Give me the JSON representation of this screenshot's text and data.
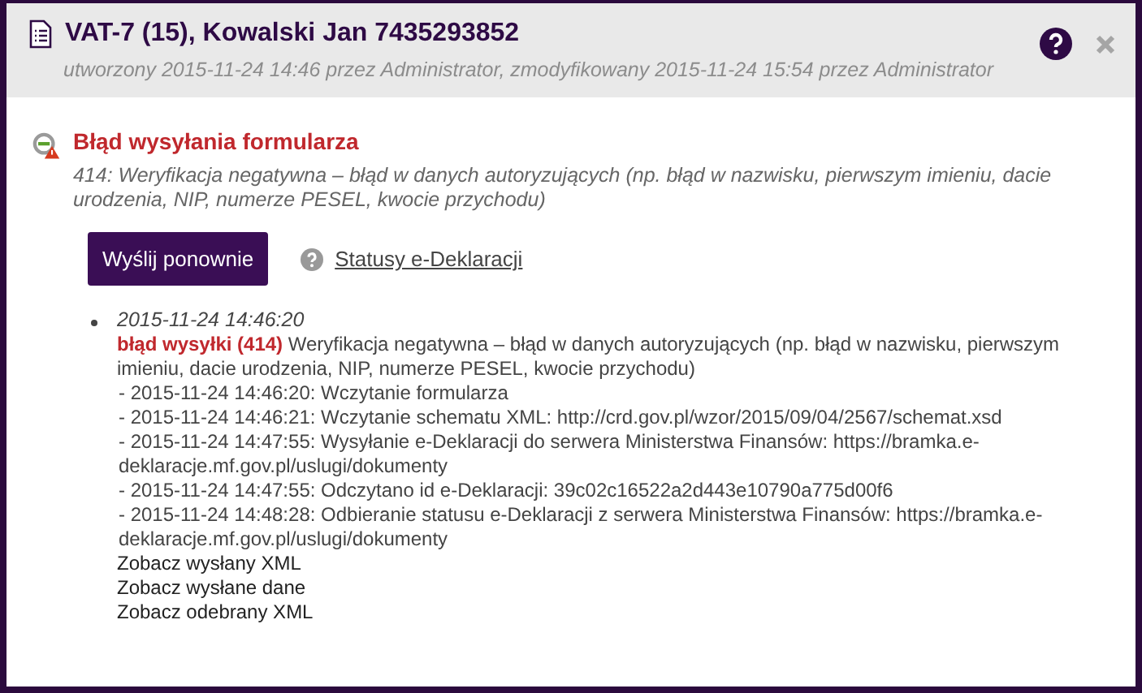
{
  "dialog": {
    "title": "VAT-7 (15), Kowalski Jan 7435293852",
    "subtitle": "utworzony 2015-11-24 14:46 przez Administrator, zmodyfikowany 2015-11-24 15:54 przez Administrator"
  },
  "error": {
    "title": "Błąd wysyłania formularza",
    "message": "414: Weryfikacja negatywna – błąd w danych autoryzujących (np. błąd w nazwisku, pierwszym imieniu, dacie urodzenia, NIP, numerze PESEL, kwocie przychodu)"
  },
  "actions": {
    "button": "Wyślij ponownie",
    "link": "Statusy e-Deklaracji"
  },
  "log": [
    {
      "time": "2015-11-24 14:46:20",
      "summary": "**błąd wysyłki (414)** Weryfikacja negatywna – błąd w danych autoryzujących (np. błąd w nazwisku, pierwszym imieniu, dacie urodzenia, NIP, numerze PESEL, kwocie przychodu)",
      "steps": [
        "- 2015-11-24 14:46:20: Wczytanie formularza",
        "- 2015-11-24 14:46:21: Wczytanie schematu XML: http://crd.gov.pl/wzor/2015/09/04/2567/schemat.xsd",
        "- 2015-11-24 14:47:55: Wysyłanie e-Deklaracji do serwera Ministerstwa Finansów: https://bramka.e-deklaracje.mf.gov.pl/uslugi/dokumenty",
        "- 2015-11-24 14:47:55: Odczytano id e-Deklaracji: 39c02c16522a2d443e10790a775d00f6",
        "- 2015-11-24 14:48:28: Odbieranie statusu e-Deklaracji z serwera Ministerstwa Finansów: https://bramka.e-deklaracje.mf.gov.pl/uslugi/dokumenty"
      ],
      "links": [
        "Zobacz wysłany XML",
        "Zobacz wysłane dane",
        "Zobacz odebrany XML"
      ]
    }
  ]
}
